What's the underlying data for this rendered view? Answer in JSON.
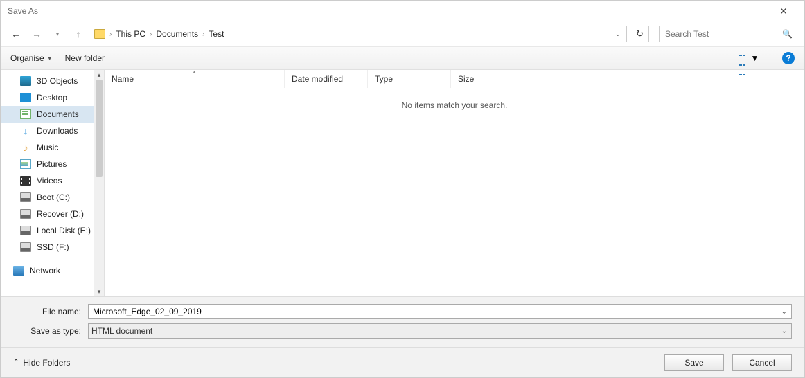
{
  "window": {
    "title": "Save As"
  },
  "nav": {
    "breadcrumb": [
      "This PC",
      "Documents",
      "Test"
    ],
    "search_placeholder": "Search Test"
  },
  "toolbar": {
    "organise": "Organise",
    "newfolder": "New folder"
  },
  "sidebar": {
    "items": [
      {
        "label": "3D Objects",
        "icon": "3d"
      },
      {
        "label": "Desktop",
        "icon": "desktop"
      },
      {
        "label": "Documents",
        "icon": "doc",
        "selected": true
      },
      {
        "label": "Downloads",
        "icon": "dl"
      },
      {
        "label": "Music",
        "icon": "music"
      },
      {
        "label": "Pictures",
        "icon": "pic"
      },
      {
        "label": "Videos",
        "icon": "vid"
      },
      {
        "label": "Boot (C:)",
        "icon": "drive"
      },
      {
        "label": "Recover (D:)",
        "icon": "drive"
      },
      {
        "label": "Local Disk (E:)",
        "icon": "drive"
      },
      {
        "label": "SSD (F:)",
        "icon": "drive"
      }
    ],
    "network": "Network"
  },
  "columns": {
    "name": "Name",
    "date": "Date modified",
    "type": "Type",
    "size": "Size"
  },
  "main": {
    "empty_message": "No items match your search."
  },
  "form": {
    "filename_label": "File name:",
    "filename_value": "Microsoft_Edge_02_09_2019",
    "savetype_label": "Save as type:",
    "savetype_value": "HTML document"
  },
  "actions": {
    "hide_folders": "Hide Folders",
    "save": "Save",
    "cancel": "Cancel"
  }
}
